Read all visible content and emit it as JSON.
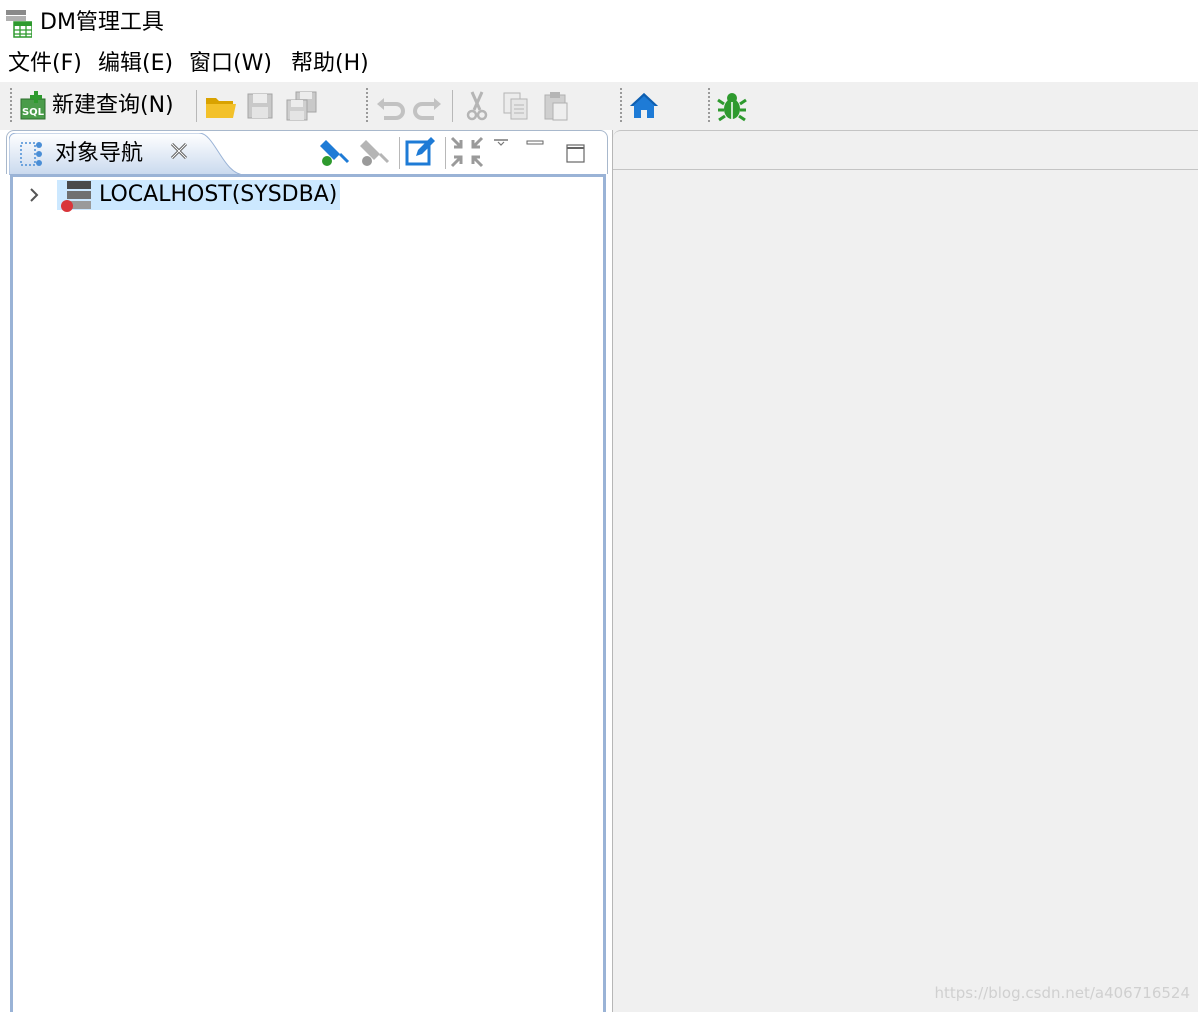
{
  "window": {
    "title": "DM管理工具",
    "icon": "table-grid-icon"
  },
  "menubar": {
    "items": [
      {
        "label": "文件(F)"
      },
      {
        "label": "编辑(E)"
      },
      {
        "label": "窗口(W)"
      },
      {
        "label": "帮助(H)"
      }
    ]
  },
  "toolbar": {
    "new_query_label": "新建查询(N)",
    "buttons": [
      "sql-new-query-icon",
      "open-folder-icon",
      "save-icon",
      "save-all-icon",
      "undo-icon",
      "redo-icon",
      "cut-icon",
      "copy-icon",
      "paste-icon",
      "home-icon",
      "debug-bug-icon"
    ]
  },
  "object_nav": {
    "tab_label": "对象导航",
    "tree": [
      {
        "label": "LOCALHOST(SYSDBA)",
        "expanded": false,
        "selected": true
      }
    ]
  },
  "watermark": "https://blog.csdn.net/a406716524",
  "colors": {
    "accent_blue": "#1e7bd6",
    "selection": "#cce8ff",
    "toolbar_bg": "#f0f0f0",
    "green_icon": "#2e9a2e"
  }
}
